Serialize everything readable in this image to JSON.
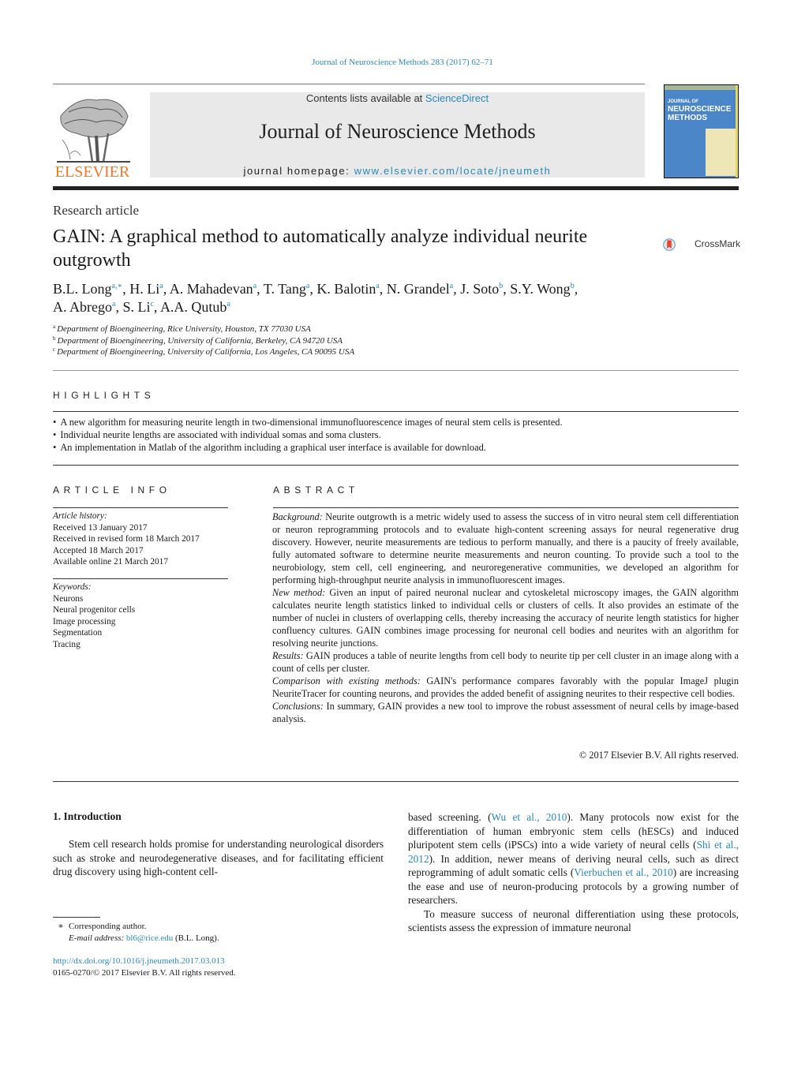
{
  "citation": "Journal of Neuroscience Methods 283 (2017) 62–71",
  "header": {
    "publisher_logo_text": "ELSEVIER",
    "contents_prefix": "Contents lists available at ",
    "contents_link": "ScienceDirect",
    "journal_name": "Journal of Neuroscience Methods",
    "homepage_prefix": "journal homepage: ",
    "homepage_link": "www.elsevier.com/locate/jneumeth",
    "cover": {
      "small_text": "JOURNAL OF",
      "title_line1": "NEUROSCIENCE",
      "title_line2": "METHODS"
    }
  },
  "article": {
    "type": "Research article",
    "title": "GAIN: A graphical method to automatically analyze individual neurite outgrowth",
    "crossmark_label": "CrossMark",
    "authors": [
      {
        "name": "B.L. Long",
        "aff": "a,∗"
      },
      {
        "name": "H. Li",
        "aff": "a"
      },
      {
        "name": "A. Mahadevan",
        "aff": "a"
      },
      {
        "name": "T. Tang",
        "aff": "a"
      },
      {
        "name": "K. Balotin",
        "aff": "a"
      },
      {
        "name": "N. Grandel",
        "aff": "a"
      },
      {
        "name": "J. Soto",
        "aff": "b"
      },
      {
        "name": "S.Y. Wong",
        "aff": "b"
      },
      {
        "name": "A. Abrego",
        "aff": "a"
      },
      {
        "name": "S. Li",
        "aff": "c"
      },
      {
        "name": "A.A. Qutub",
        "aff": "a"
      }
    ],
    "affiliations": [
      {
        "key": "a",
        "text": "Department of Bioengineering, Rice University, Houston, TX 77030 USA"
      },
      {
        "key": "b",
        "text": "Department of Bioengineering, University of California, Berkeley, CA 94720 USA"
      },
      {
        "key": "c",
        "text": "Department of Bioengineering, University of California, Los Angeles, CA 90095 USA"
      }
    ]
  },
  "highlights": {
    "heading": "HIGHLIGHTS",
    "items": [
      "A new algorithm for measuring neurite length in two-dimensional immunofluorescence images of neural stem cells is presented.",
      "Individual neurite lengths are associated with individual somas and soma clusters.",
      "An implementation in Matlab of the algorithm including a graphical user interface is available for download."
    ]
  },
  "article_info": {
    "heading": "ARTICLE INFO",
    "history_label": "Article history:",
    "history": [
      "Received 13 January 2017",
      "Received in revised form 18 March 2017",
      "Accepted 18 March 2017",
      "Available online 21 March 2017"
    ],
    "keywords_label": "Keywords:",
    "keywords": [
      "Neurons",
      "Neural progenitor cells",
      "Image processing",
      "Segmentation",
      "Tracing"
    ]
  },
  "abstract": {
    "heading": "ABSTRACT",
    "sections": [
      {
        "label": "Background:",
        "text": " Neurite outgrowth is a metric widely used to assess the success of in vitro neural stem cell differentiation or neuron reprogramming protocols and to evaluate high-content screening assays for neural regenerative drug discovery. However, neurite measurements are tedious to perform manually, and there is a paucity of freely available, fully automated software to determine neurite measurements and neuron counting. To provide such a tool to the neurobiology, stem cell, cell engineering, and neuroregenerative communities, we developed an algorithm for performing high-throughput neurite analysis in immunofluorescent images."
      },
      {
        "label": "New method:",
        "text": " Given an input of paired neuronal nuclear and cytoskeletal microscopy images, the GAIN algorithm calculates neurite length statistics linked to individual cells or clusters of cells. It also provides an estimate of the number of nuclei in clusters of overlapping cells, thereby increasing the accuracy of neurite length statistics for higher confluency cultures. GAIN combines image processing for neuronal cell bodies and neurites with an algorithm for resolving neurite junctions."
      },
      {
        "label": "Results:",
        "text": " GAIN produces a table of neurite lengths from cell body to neurite tip per cell cluster in an image along with a count of cells per cluster."
      },
      {
        "label": "Comparison with existing methods:",
        "text": " GAIN's performance compares favorably with the popular ImageJ plugin NeuriteTracer for counting neurons, and provides the added benefit of assigning neurites to their respective cell bodies."
      },
      {
        "label": "Conclusions:",
        "text": " In summary, GAIN provides a new tool to improve the robust assessment of neural cells by image-based analysis."
      }
    ],
    "copyright": "© 2017 Elsevier B.V. All rights reserved."
  },
  "introduction": {
    "heading": "1.  Introduction",
    "col1": "Stem cell research holds promise for understanding neurological disorders such as stroke and neurodegenerative diseases, and for facilitating efficient drug discovery using high-content cell-",
    "col2_p1": [
      {
        "t": "based screening. ("
      },
      {
        "t": "Wu et al., 2010",
        "link": true
      },
      {
        "t": "). Many protocols now exist for the differentiation of human embryonic stem cells (hESCs) and induced pluripotent stem cells (iPSCs) into a wide variety of neural cells ("
      },
      {
        "t": "Shi et al., 2012",
        "link": true
      },
      {
        "t": "). In addition, newer means of deriving neural cells, such as direct reprogramming of adult somatic cells ("
      },
      {
        "t": "Vierbuchen et al., 2010",
        "link": true
      },
      {
        "t": ") are increasing the ease and use of neuron-producing protocols by a growing number of researchers."
      }
    ],
    "col2_p2": "To measure success of neuronal differentiation using these protocols, scientists assess the expression of immature neuronal"
  },
  "footnotes": {
    "star": "∗",
    "corresponding": "Corresponding author.",
    "email_label": "E-mail address:",
    "email": "bl6@rice.edu",
    "email_suffix": " (B.L. Long).",
    "doi": "http://dx.doi.org/10.1016/j.jneumeth.2017.03.013",
    "issn_copyright": "0165-0270/© 2017 Elsevier B.V. All rights reserved."
  },
  "colors": {
    "link": "#2a8ab8",
    "elsevier_orange": "#f0782e",
    "masthead_gray": "#e9e9e9",
    "cover_blue": "#4a86c8"
  }
}
